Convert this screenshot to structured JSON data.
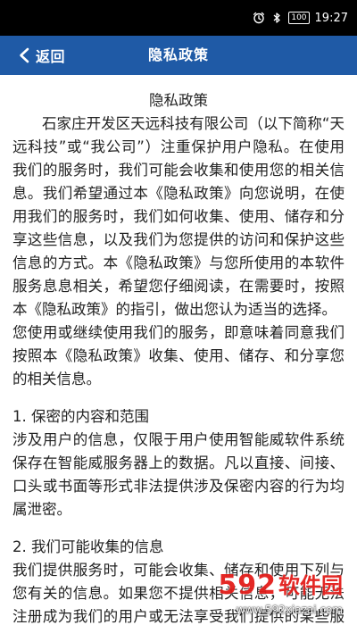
{
  "status_bar": {
    "battery": "100",
    "time": "19:27",
    "icons": [
      "alarm-icon",
      "bluetooth-icon",
      "battery-icon"
    ]
  },
  "nav": {
    "back_label": "返回",
    "title": "隐私政策",
    "back_icon": "chevron-left-icon"
  },
  "document": {
    "heading": "隐私政策",
    "intro_paragraphs": [
      "石家庄开发区天远科技有限公司（以下简称“天远科技”或“我公司”）注重保护用户隐私。在使用我们的服务时，我们可能会收集和使用您的相关信息。我们希望通过本《隐私政策》向您说明，在使用我们的服务时，我们如何收集、使用、储存和分享这些信息，以及我们为您提供的访问和保护这些信息的方式。本《隐私政策》与您所使用的本软件服务息息相关，希望您仔细阅读，在需要时，按照本《隐私政策》的指引，做出您认为适当的选择。",
      "您使用或继续使用我们的服务，即意味着同意我们按照本《隐私政策》收集、使用、储存、和分享您的相关信息。"
    ],
    "sections": [
      {
        "title": "1. 保密的内容和范围",
        "body": "涉及用户的信息，仅限于用户使用智能威软件系统保存在智能威服务器上的数据。凡以直接、间接、口头或书面等形式非法提供涉及保密内容的行为均属泄密。"
      },
      {
        "title": "2. 我们可能收集的信息",
        "body": "我们提供服务时，可能会收集、储存和使用下列与您有关的信息。如果您不提供相关信息，可能无法注册成为我们的用户或无法享受我们提供的某些服务，或者无法达到相关服务拟达到的效果。"
      }
    ]
  },
  "watermark": {
    "number": "592",
    "cn_text": "软件园",
    "url": "www.592xiazai.com"
  }
}
